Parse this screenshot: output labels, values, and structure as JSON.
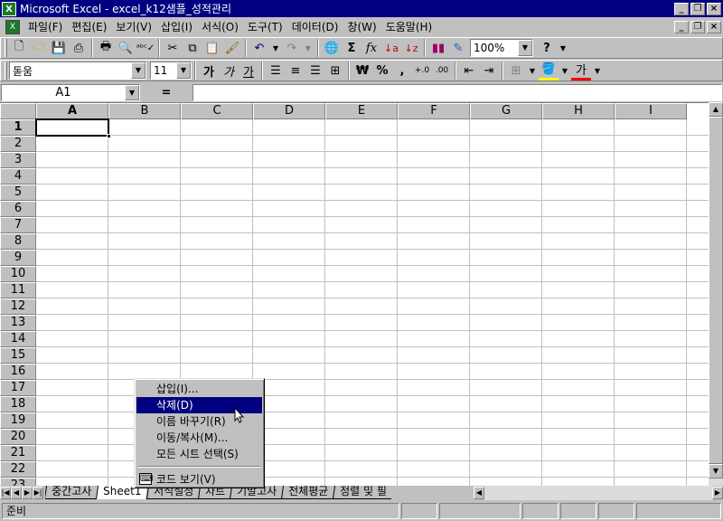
{
  "window": {
    "title": "Microsoft Excel - excel_k12샘플_성적관리",
    "app_icon": "excel-logo-icon",
    "controls": [
      "minimize-icon",
      "restore-icon",
      "close-icon"
    ]
  },
  "menubar": {
    "items": [
      "파일(F)",
      "편집(E)",
      "보기(V)",
      "삽입(I)",
      "서식(O)",
      "도구(T)",
      "데이터(D)",
      "창(W)",
      "도움말(H)"
    ]
  },
  "toolbar_standard": {
    "zoom": "100%"
  },
  "toolbar_format": {
    "font_name": "돋움",
    "font_size": "11",
    "bold_label": "가",
    "italic_label": "가",
    "underline_label": "가",
    "currency_label": "₩",
    "percent_label": "%",
    "comma_label": ",",
    "font_color_label": "가"
  },
  "formula_bar": {
    "name_box": "A1",
    "equals": "=",
    "formula": ""
  },
  "grid": {
    "columns": [
      "A",
      "B",
      "C",
      "D",
      "E",
      "F",
      "G",
      "H",
      "I"
    ],
    "rows": [
      "1",
      "2",
      "3",
      "4",
      "5",
      "6",
      "7",
      "8",
      "9",
      "10",
      "11",
      "12",
      "13",
      "14",
      "15",
      "16",
      "17",
      "18",
      "19",
      "20",
      "21",
      "22",
      "23"
    ],
    "selected_column": "A",
    "selected_row": "1"
  },
  "sheet_tabs": {
    "tabs": [
      "중간고사",
      "Sheet1",
      "서식설정",
      "차트",
      "기말고사",
      "전체평균",
      "정렬 및 필"
    ],
    "active": "Sheet1"
  },
  "status": {
    "text": "준비"
  },
  "context_menu": {
    "items": [
      {
        "label": "삽입(I)..."
      },
      {
        "label": "삭제(D)",
        "highlighted": true
      },
      {
        "label": "이름 바꾸기(R)"
      },
      {
        "label": "이동/복사(M)..."
      },
      {
        "label": "모든 시트 선택(S)"
      }
    ],
    "view_code": "코드 보기(V)",
    "view_code_icon": "view-code-icon"
  },
  "colors": {
    "title_bar": "#000080",
    "face": "#c0c0c0",
    "highlight": "#000080",
    "grid_line": "#c0c0c0"
  }
}
